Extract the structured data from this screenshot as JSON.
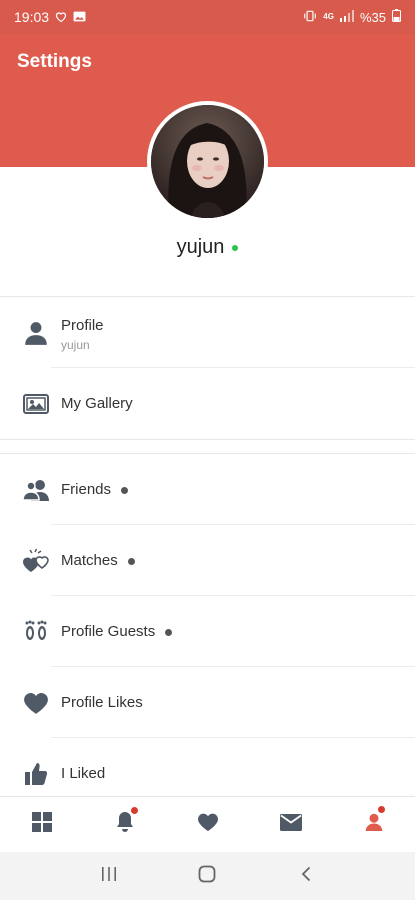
{
  "status_bar": {
    "time": "19:03",
    "battery": "%35",
    "network": "4G"
  },
  "app_bar": {
    "title": "Settings"
  },
  "profile_header": {
    "username": "yujun",
    "online": true
  },
  "menu_group_1": [
    {
      "label": "Profile",
      "sublabel": "yujun",
      "icon": "person-icon"
    },
    {
      "label": "My Gallery",
      "icon": "gallery-icon"
    }
  ],
  "menu_group_2": [
    {
      "label": "Friends",
      "icon": "friends-icon",
      "has_dot": true
    },
    {
      "label": "Matches",
      "icon": "matches-icon",
      "has_dot": true
    },
    {
      "label": "Profile Guests",
      "icon": "footprints-icon",
      "has_dot": true
    },
    {
      "label": "Profile Likes",
      "icon": "heart-icon",
      "has_dot": false
    },
    {
      "label": "I Liked",
      "icon": "thumbs-up-icon",
      "has_dot": false
    }
  ],
  "bottom_nav": [
    {
      "icon": "grid-icon",
      "badge": false,
      "active": false
    },
    {
      "icon": "bell-icon",
      "badge": true,
      "active": false
    },
    {
      "icon": "heart-icon",
      "badge": false,
      "active": false
    },
    {
      "icon": "mail-icon",
      "badge": false,
      "active": false
    },
    {
      "icon": "user-icon",
      "badge": true,
      "active": true
    }
  ],
  "colors": {
    "primary": "#df5b4e",
    "icon": "#505a66",
    "online": "#2ec24a",
    "badge": "#d63a2e"
  }
}
